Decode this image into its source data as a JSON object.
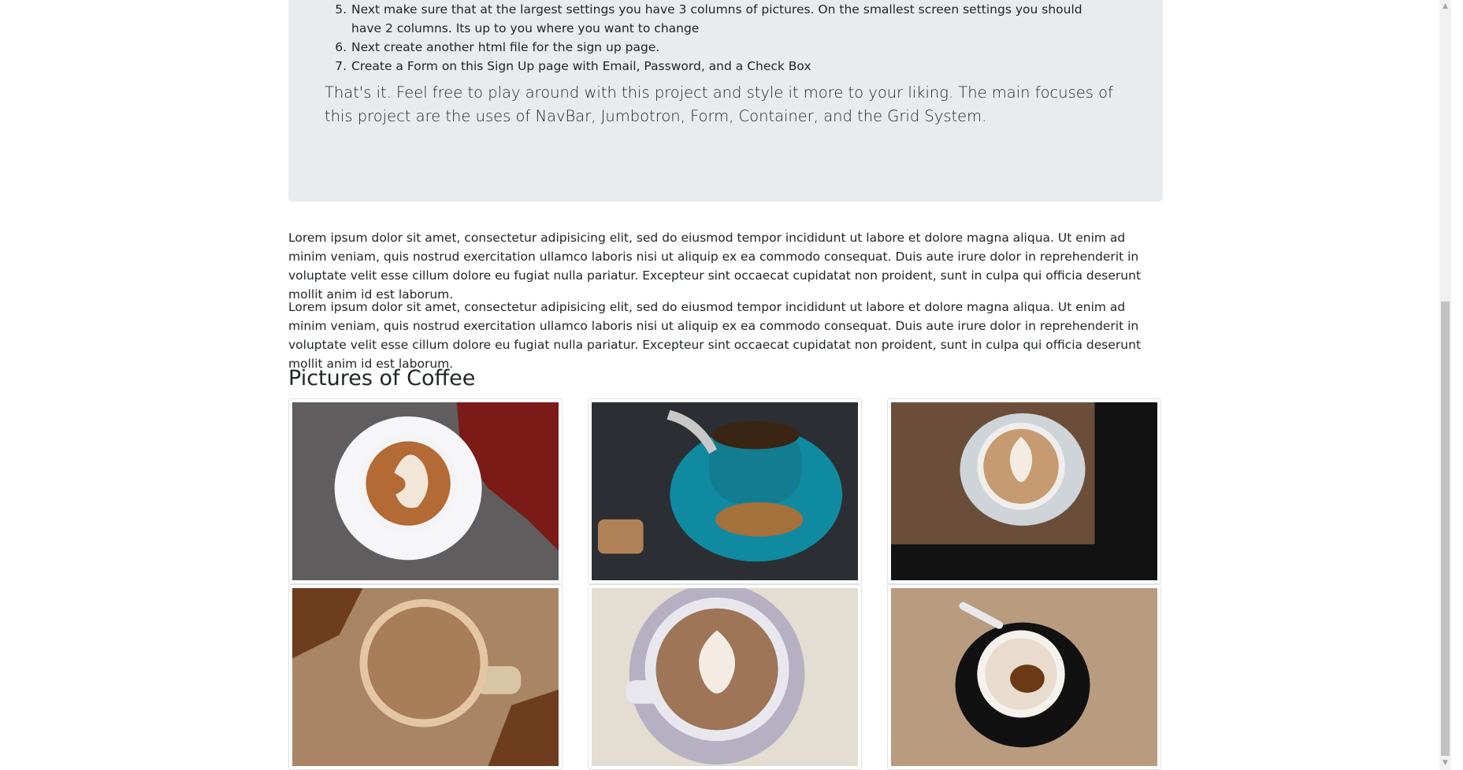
{
  "instructions": {
    "steps": [
      {
        "num": "5.",
        "text": "Next make sure that at the largest settings you have 3 columns of pictures. On the smallest screen settings you should have 2 columns. Its up to you where you want to change"
      },
      {
        "num": "6.",
        "text": "Next create another html file for the sign up page."
      },
      {
        "num": "7.",
        "text": "Create a Form on this Sign Up page with Email, Password, and a Check Box"
      }
    ],
    "lead": "That's it. Feel free to play around with this project and style it more to your liking. The main focuses of this project are the uses of NavBar, Jumbotron, Form, Container, and the Grid System."
  },
  "paragraphs": [
    "Lorem ipsum dolor sit amet, consectetur adipisicing elit, sed do eiusmod tempor incididunt ut labore et dolore magna aliqua. Ut enim ad minim veniam, quis nostrud exercitation ullamco laboris nisi ut aliquip ex ea commodo consequat. Duis aute irure dolor in reprehenderit in voluptate velit esse cillum dolore eu fugiat nulla pariatur. Excepteur sint occaecat cupidatat non proident, sunt in culpa qui officia deserunt mollit anim id est laborum.",
    "Lorem ipsum dolor sit amet, consectetur adipisicing elit, sed do eiusmod tempor incididunt ut labore et dolore magna aliqua. Ut enim ad minim veniam, quis nostrud exercitation ullamco laboris nisi ut aliquip ex ea commodo consequat. Duis aute irure dolor in reprehenderit in voluptate velit esse cillum dolore eu fugiat nulla pariatur. Excepteur sint occaecat cupidatat non proident, sunt in culpa qui officia deserunt mollit anim id est laborum."
  ],
  "gallery": {
    "title": "Pictures of Coffee",
    "images": [
      {
        "name": "latte-art-swan-on-white-saucer-with-red-leaves",
        "bg": "#5f5d5d",
        "accent": "#7a1b18",
        "cup": "#f4f4f6",
        "coffee": "#b46a35"
      },
      {
        "name": "espresso-in-teal-cup-with-biscotti",
        "bg": "#2b2f33",
        "accent": "#0f8aa0",
        "cup": "#127c90",
        "coffee": "#3a2414"
      },
      {
        "name": "latte-art-heart-on-wooden-table",
        "bg": "#6b4e3a",
        "accent": "#121212",
        "cup": "#f0eeec",
        "coffee": "#c79b71"
      },
      {
        "name": "frothy-coffee-mug-with-autumn-leaves",
        "bg": "#a98565",
        "accent": "#6d3d1e",
        "cup": "#e3c7a5",
        "coffee": "#a97d57"
      },
      {
        "name": "latte-art-tulip-in-white-cup",
        "bg": "#e4ddd2",
        "accent": "#b5b1c2",
        "cup": "#e9e7ee",
        "coffee": "#9e7556"
      },
      {
        "name": "empty-espresso-cup-on-black-saucer",
        "bg": "#b99b80",
        "accent": "#111111",
        "cup": "#f5f2ee",
        "coffee": "#6b3a14"
      }
    ]
  },
  "scrollbar": {
    "up_icon": "triangle-up-icon",
    "down_icon": "triangle-down-icon",
    "up_glyph": "▲",
    "down_glyph": "▼"
  }
}
